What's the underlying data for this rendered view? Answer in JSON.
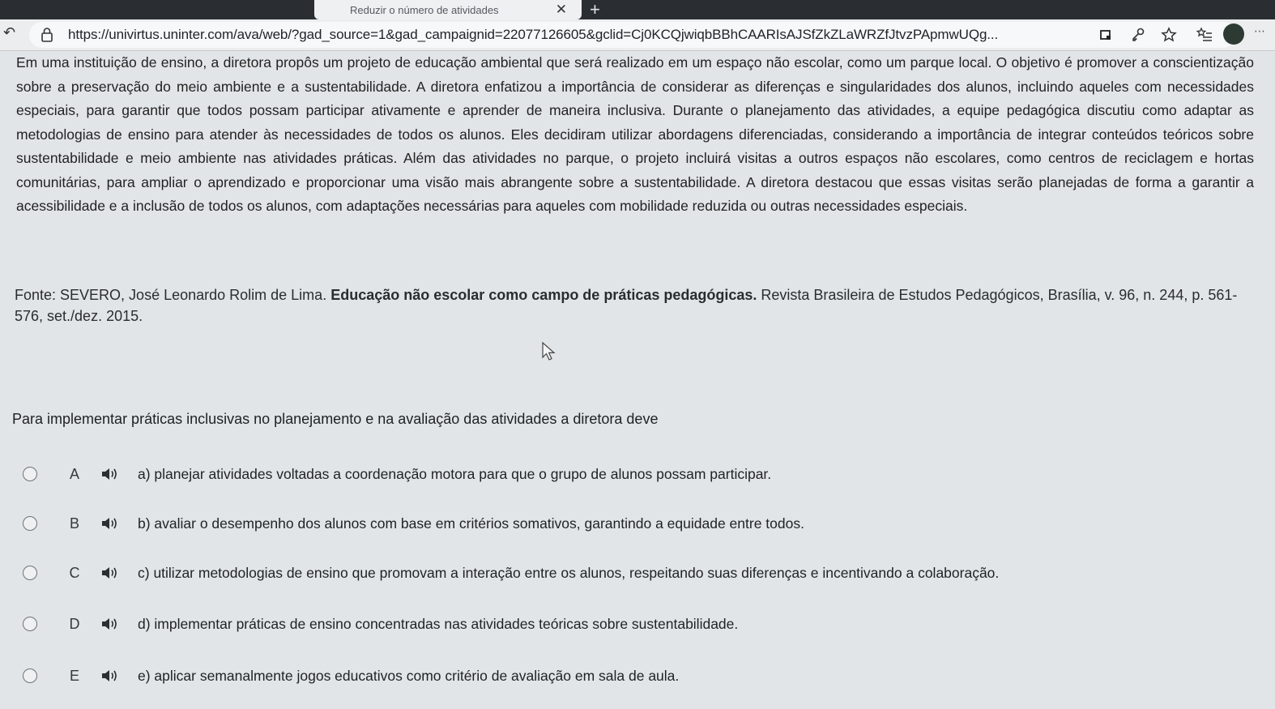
{
  "browser": {
    "tab_title": "Reduzir o número de atividades",
    "tab_close": "✕",
    "new_tab": "+",
    "url": "https://univirtus.uninter.com/ava/web/?gad_source=1&gad_campaignid=22077126605&gclid=Cj0KCQjwiqbBBhCAARIsAJSfZkZLaWRZfJtvzPApmwUQg..."
  },
  "passage": {
    "text": "Em uma instituição de ensino, a diretora propôs um projeto de educação ambiental que será realizado em um espaço não escolar, como um parque local. O objetivo é promover a conscientização sobre a preservação do meio ambiente e a sustentabilidade. A diretora enfatizou a importância de considerar as diferenças e singularidades dos alunos, incluindo aqueles com necessidades especiais, para garantir que todos possam participar ativamente e aprender de maneira inclusiva. Durante o planejamento das atividades, a equipe pedagógica discutiu como adaptar as metodologias de ensino para atender às necessidades de todos os alunos. Eles decidiram utilizar abordagens diferenciadas, considerando a importância de integrar conteúdos teóricos sobre sustentabilidade e meio ambiente nas atividades práticas. Além das atividades no parque, o projeto incluirá visitas a outros espaços não escolares, como centros de reciclagem e hortas comunitárias, para ampliar o aprendizado e proporcionar uma visão mais abrangente sobre a sustentabilidade. A diretora destacou que essas visitas serão planejadas de forma a garantir a acessibilidade e a inclusão de todos os alunos, com adaptações necessárias para aqueles com mobilidade reduzida ou outras necessidades especiais."
  },
  "source": {
    "prefix": "Fonte:  SEVERO, José Leonardo Rolim de Lima. ",
    "title": "Educação não escolar como campo de práticas pedagógicas.",
    "suffix": " Revista Brasileira de Estudos Pedagógicos, Brasília, v. 96, n. 244, p. 561-576, set./dez. 2015."
  },
  "question": "Para implementar práticas inclusivas no planejamento e na avaliação das atividades a diretora deve",
  "options": [
    {
      "letter": "A",
      "text": "a) planejar atividades voltadas a coordenação motora para que o grupo de alunos possam participar."
    },
    {
      "letter": "B",
      "text": "b) avaliar o desempenho dos alunos com base em critérios somativos, garantindo a equidade entre todos."
    },
    {
      "letter": "C",
      "text": "c) utilizar metodologias de ensino que promovam a interação entre os alunos, respeitando suas diferenças e incentivando a colaboração."
    },
    {
      "letter": "D",
      "text": "d) implementar práticas de ensino concentradas nas atividades teóricas sobre sustentabilidade."
    },
    {
      "letter": "E",
      "text": "e) aplicar semanalmente jogos educativos como critério de avaliação em sala de aula."
    }
  ]
}
